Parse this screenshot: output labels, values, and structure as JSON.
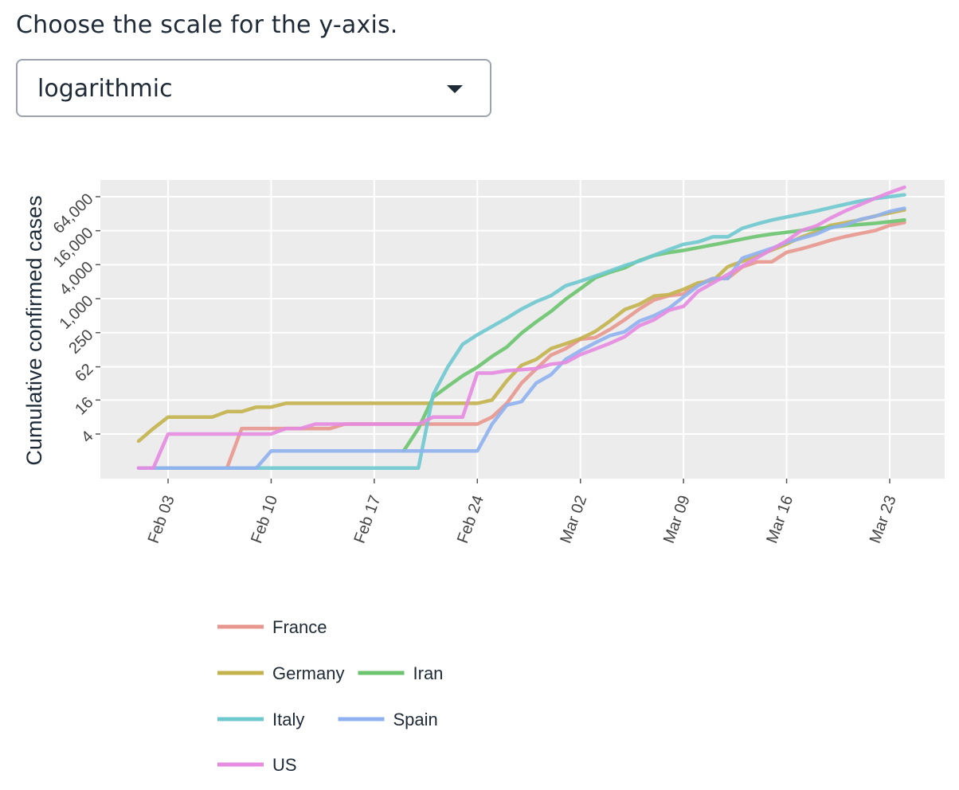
{
  "prompt": "Choose the scale for the y-axis.",
  "scale_select": {
    "selected": "logarithmic",
    "caret_icon": "caret-down-icon"
  },
  "chart_data": {
    "type": "line",
    "title": "",
    "xlabel": "",
    "ylabel": "Cumulative confirmed cases",
    "yscale": "log2",
    "ylim": [
      1,
      100000
    ],
    "y_ticks": [
      4,
      16,
      62,
      250,
      1000,
      4000,
      16000,
      64000
    ],
    "y_tick_labels": [
      "4",
      "16",
      "62",
      "250",
      "1,000",
      "4,000",
      "16,000",
      "64,000"
    ],
    "x_ticks": [
      "2020-02-03",
      "2020-02-10",
      "2020-02-17",
      "2020-02-24",
      "2020-03-02",
      "2020-03-09",
      "2020-03-16",
      "2020-03-23"
    ],
    "x_tick_labels": [
      "Feb 03",
      "Feb 10",
      "Feb 17",
      "Feb 24",
      "Mar 02",
      "Mar 09",
      "Mar 16",
      "Mar 23"
    ],
    "xlim": [
      "2020-01-30",
      "2020-03-25"
    ],
    "grid": true,
    "legend": "bottom",
    "series": [
      {
        "name": "France",
        "color": "#e8978e",
        "points": [
          [
            "2020-02-01",
            1
          ],
          [
            "2020-02-07",
            1
          ],
          [
            "2020-02-08",
            5
          ],
          [
            "2020-02-14",
            5
          ],
          [
            "2020-02-15",
            6
          ],
          [
            "2020-02-24",
            6
          ],
          [
            "2020-02-25",
            8
          ],
          [
            "2020-02-26",
            14
          ],
          [
            "2020-02-27",
            32
          ],
          [
            "2020-02-28",
            57
          ],
          [
            "2020-02-29",
            100
          ],
          [
            "2020-03-01",
            130
          ],
          [
            "2020-03-02",
            191
          ],
          [
            "2020-03-03",
            204
          ],
          [
            "2020-03-04",
            285
          ],
          [
            "2020-03-05",
            423
          ],
          [
            "2020-03-06",
            653
          ],
          [
            "2020-03-07",
            949
          ],
          [
            "2020-03-08",
            1126
          ],
          [
            "2020-03-09",
            1209
          ],
          [
            "2020-03-10",
            1784
          ],
          [
            "2020-03-11",
            2281
          ],
          [
            "2020-03-12",
            2281
          ],
          [
            "2020-03-13",
            3661
          ],
          [
            "2020-03-14",
            4469
          ],
          [
            "2020-03-15",
            4499
          ],
          [
            "2020-03-16",
            6633
          ],
          [
            "2020-03-17",
            7652
          ],
          [
            "2020-03-18",
            9043
          ],
          [
            "2020-03-19",
            10871
          ],
          [
            "2020-03-20",
            12612
          ],
          [
            "2020-03-21",
            14282
          ],
          [
            "2020-03-22",
            16018
          ],
          [
            "2020-03-23",
            19856
          ],
          [
            "2020-03-24",
            22304
          ]
        ]
      },
      {
        "name": "Germany",
        "color": "#c4b34c",
        "points": [
          [
            "2020-02-01",
            3
          ],
          [
            "2020-02-02",
            5
          ],
          [
            "2020-02-03",
            8
          ],
          [
            "2020-02-06",
            8
          ],
          [
            "2020-02-07",
            10
          ],
          [
            "2020-02-08",
            10
          ],
          [
            "2020-02-09",
            12
          ],
          [
            "2020-02-10",
            12
          ],
          [
            "2020-02-11",
            14
          ],
          [
            "2020-02-24",
            14
          ],
          [
            "2020-02-25",
            16
          ],
          [
            "2020-02-26",
            35
          ],
          [
            "2020-02-27",
            66
          ],
          [
            "2020-02-28",
            84
          ],
          [
            "2020-02-29",
            130
          ],
          [
            "2020-03-01",
            159
          ],
          [
            "2020-03-02",
            196
          ],
          [
            "2020-03-03",
            262
          ],
          [
            "2020-03-04",
            400
          ],
          [
            "2020-03-05",
            639
          ],
          [
            "2020-03-06",
            795
          ],
          [
            "2020-03-07",
            1112
          ],
          [
            "2020-03-08",
            1176
          ],
          [
            "2020-03-09",
            1457
          ],
          [
            "2020-03-10",
            1908
          ],
          [
            "2020-03-11",
            2078
          ],
          [
            "2020-03-12",
            3675
          ],
          [
            "2020-03-13",
            4585
          ],
          [
            "2020-03-14",
            5795
          ],
          [
            "2020-03-15",
            7272
          ],
          [
            "2020-03-16",
            9257
          ],
          [
            "2020-03-17",
            12327
          ],
          [
            "2020-03-18",
            15320
          ],
          [
            "2020-03-19",
            19848
          ],
          [
            "2020-03-20",
            22213
          ],
          [
            "2020-03-21",
            24873
          ],
          [
            "2020-03-22",
            29056
          ],
          [
            "2020-03-23",
            32986
          ],
          [
            "2020-03-24",
            37323
          ]
        ]
      },
      {
        "name": "Iran",
        "color": "#6cc46f",
        "points": [
          [
            "2020-02-19",
            2
          ],
          [
            "2020-02-20",
            5
          ],
          [
            "2020-02-21",
            18
          ],
          [
            "2020-02-22",
            28
          ],
          [
            "2020-02-23",
            43
          ],
          [
            "2020-02-24",
            61
          ],
          [
            "2020-02-25",
            95
          ],
          [
            "2020-02-26",
            139
          ],
          [
            "2020-02-27",
            245
          ],
          [
            "2020-02-28",
            388
          ],
          [
            "2020-02-29",
            593
          ],
          [
            "2020-03-01",
            978
          ],
          [
            "2020-03-02",
            1501
          ],
          [
            "2020-03-03",
            2336
          ],
          [
            "2020-03-04",
            2922
          ],
          [
            "2020-03-05",
            3513
          ],
          [
            "2020-03-06",
            4747
          ],
          [
            "2020-03-07",
            5823
          ],
          [
            "2020-03-08",
            6566
          ],
          [
            "2020-03-09",
            7161
          ],
          [
            "2020-03-10",
            8042
          ],
          [
            "2020-03-11",
            9000
          ],
          [
            "2020-03-12",
            10075
          ],
          [
            "2020-03-13",
            11364
          ],
          [
            "2020-03-14",
            12729
          ],
          [
            "2020-03-15",
            13938
          ],
          [
            "2020-03-16",
            14991
          ],
          [
            "2020-03-17",
            16169
          ],
          [
            "2020-03-18",
            17361
          ],
          [
            "2020-03-19",
            18407
          ],
          [
            "2020-03-20",
            19644
          ],
          [
            "2020-03-21",
            20610
          ],
          [
            "2020-03-22",
            21638
          ],
          [
            "2020-03-23",
            23049
          ],
          [
            "2020-03-24",
            24811
          ]
        ]
      },
      {
        "name": "Italy",
        "color": "#6ec9cf",
        "points": [
          [
            "2020-02-01",
            1
          ],
          [
            "2020-02-20",
            1
          ],
          [
            "2020-02-21",
            20
          ],
          [
            "2020-02-22",
            62
          ],
          [
            "2020-02-23",
            155
          ],
          [
            "2020-02-24",
            229
          ],
          [
            "2020-02-25",
            322
          ],
          [
            "2020-02-26",
            453
          ],
          [
            "2020-02-27",
            655
          ],
          [
            "2020-02-28",
            888
          ],
          [
            "2020-02-29",
            1128
          ],
          [
            "2020-03-01",
            1694
          ],
          [
            "2020-03-02",
            2036
          ],
          [
            "2020-03-03",
            2502
          ],
          [
            "2020-03-04",
            3089
          ],
          [
            "2020-03-05",
            3858
          ],
          [
            "2020-03-06",
            4636
          ],
          [
            "2020-03-07",
            5883
          ],
          [
            "2020-03-08",
            7375
          ],
          [
            "2020-03-09",
            9172
          ],
          [
            "2020-03-10",
            10149
          ],
          [
            "2020-03-11",
            12462
          ],
          [
            "2020-03-12",
            12462
          ],
          [
            "2020-03-13",
            17660
          ],
          [
            "2020-03-14",
            21157
          ],
          [
            "2020-03-15",
            24747
          ],
          [
            "2020-03-16",
            27980
          ],
          [
            "2020-03-17",
            31506
          ],
          [
            "2020-03-18",
            35713
          ],
          [
            "2020-03-19",
            41035
          ],
          [
            "2020-03-20",
            47021
          ],
          [
            "2020-03-21",
            53578
          ],
          [
            "2020-03-22",
            59138
          ],
          [
            "2020-03-23",
            63927
          ],
          [
            "2020-03-24",
            69176
          ]
        ]
      },
      {
        "name": "Spain",
        "color": "#8fb1f0",
        "points": [
          [
            "2020-02-01",
            1
          ],
          [
            "2020-02-09",
            1
          ],
          [
            "2020-02-10",
            2
          ],
          [
            "2020-02-24",
            2
          ],
          [
            "2020-02-25",
            6
          ],
          [
            "2020-02-26",
            13
          ],
          [
            "2020-02-27",
            15
          ],
          [
            "2020-02-28",
            32
          ],
          [
            "2020-02-29",
            45
          ],
          [
            "2020-03-01",
            84
          ],
          [
            "2020-03-02",
            120
          ],
          [
            "2020-03-03",
            165
          ],
          [
            "2020-03-04",
            222
          ],
          [
            "2020-03-05",
            259
          ],
          [
            "2020-03-06",
            400
          ],
          [
            "2020-03-07",
            500
          ],
          [
            "2020-03-08",
            673
          ],
          [
            "2020-03-09",
            1073
          ],
          [
            "2020-03-10",
            1695
          ],
          [
            "2020-03-11",
            2277
          ],
          [
            "2020-03-12",
            2277
          ],
          [
            "2020-03-13",
            5232
          ],
          [
            "2020-03-14",
            6391
          ],
          [
            "2020-03-15",
            7798
          ],
          [
            "2020-03-16",
            9942
          ],
          [
            "2020-03-17",
            11748
          ],
          [
            "2020-03-18",
            13910
          ],
          [
            "2020-03-19",
            17963
          ],
          [
            "2020-03-20",
            20410
          ],
          [
            "2020-03-21",
            25374
          ],
          [
            "2020-03-22",
            28768
          ],
          [
            "2020-03-23",
            35136
          ],
          [
            "2020-03-24",
            39885
          ]
        ]
      },
      {
        "name": "US",
        "color": "#e68be0",
        "points": [
          [
            "2020-02-01",
            1
          ],
          [
            "2020-02-02",
            1
          ],
          [
            "2020-02-03",
            4
          ],
          [
            "2020-02-10",
            4
          ],
          [
            "2020-02-11",
            5
          ],
          [
            "2020-02-12",
            5
          ],
          [
            "2020-02-13",
            6
          ],
          [
            "2020-02-20",
            6
          ],
          [
            "2020-02-21",
            8
          ],
          [
            "2020-02-23",
            8
          ],
          [
            "2020-02-24",
            48
          ],
          [
            "2020-02-25",
            48
          ],
          [
            "2020-02-26",
            53
          ],
          [
            "2020-02-27",
            55
          ],
          [
            "2020-02-28",
            58
          ],
          [
            "2020-02-29",
            69
          ],
          [
            "2020-03-01",
            74
          ],
          [
            "2020-03-02",
            102
          ],
          [
            "2020-03-03",
            128
          ],
          [
            "2020-03-04",
            162
          ],
          [
            "2020-03-05",
            212
          ],
          [
            "2020-03-06",
            332
          ],
          [
            "2020-03-07",
            423
          ],
          [
            "2020-03-08",
            623
          ],
          [
            "2020-03-09",
            731
          ],
          [
            "2020-03-10",
            1357
          ],
          [
            "2020-03-11",
            1895
          ],
          [
            "2020-03-12",
            2682
          ],
          [
            "2020-03-13",
            3785
          ],
          [
            "2020-03-14",
            5292
          ],
          [
            "2020-03-15",
            7475
          ],
          [
            "2020-03-16",
            10593
          ],
          [
            "2020-03-17",
            16096
          ],
          [
            "2020-03-18",
            19336
          ],
          [
            "2020-03-19",
            26869
          ],
          [
            "2020-03-20",
            36014
          ],
          [
            "2020-03-21",
            46451
          ],
          [
            "2020-03-22",
            59856
          ],
          [
            "2020-03-23",
            75466
          ],
          [
            "2020-03-24",
            94220
          ]
        ]
      }
    ]
  }
}
